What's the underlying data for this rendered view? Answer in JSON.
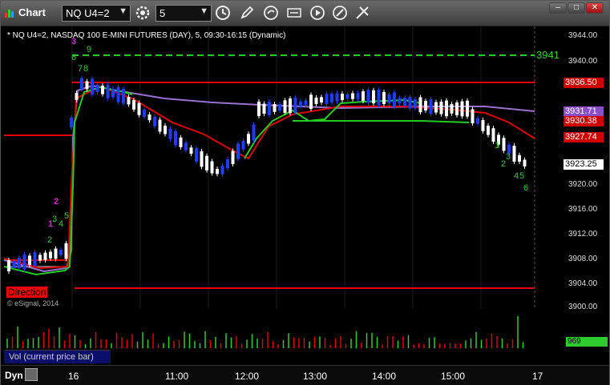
{
  "window": {
    "title": "Chart",
    "symbol_value": "NQ U4=2",
    "interval_value": "5"
  },
  "chart": {
    "info": "* NQ U4=2, NASDAQ 100 E-MINI FUTURES (DAY), 5, 09:30-16:15 (Dynamic)",
    "copyright": "© eSignal, 2014",
    "direction_label": "Direction",
    "level_label": "3941",
    "price_ticks": [
      "3944.00",
      "3940.00",
      "3920.00",
      "3916.00",
      "3912.00",
      "3908.00",
      "3904.00",
      "3900.00"
    ],
    "price_tags": [
      {
        "label": "3936.50",
        "color": "#d00000"
      },
      {
        "label": "3931.71",
        "color": "#8a4fc8"
      },
      {
        "label": "3930.38",
        "color": "#d00000"
      },
      {
        "label": "3927.74",
        "color": "#d00000"
      },
      {
        "label": "3923.25",
        "color": "#ffffff"
      }
    ],
    "seq_labels": [
      "3",
      "9",
      "6",
      "7",
      "8",
      "2",
      "1",
      "3",
      "4",
      "5",
      "2",
      "1",
      "3",
      "2",
      "4",
      "5",
      "6"
    ],
    "colors": {
      "up": "#ffffff",
      "down": "#1e3cff",
      "support": "#e00000",
      "level": "#22cc22",
      "ema": "#e00000",
      "vwap": "#9a70d0"
    }
  },
  "volume": {
    "label": "Vol (current price bar)",
    "value": "969"
  },
  "time_axis": {
    "labels": [
      "16",
      "11:00",
      "12:00",
      "13:00",
      "14:00",
      "15:00",
      "17"
    ],
    "mode": "Dyn"
  }
}
